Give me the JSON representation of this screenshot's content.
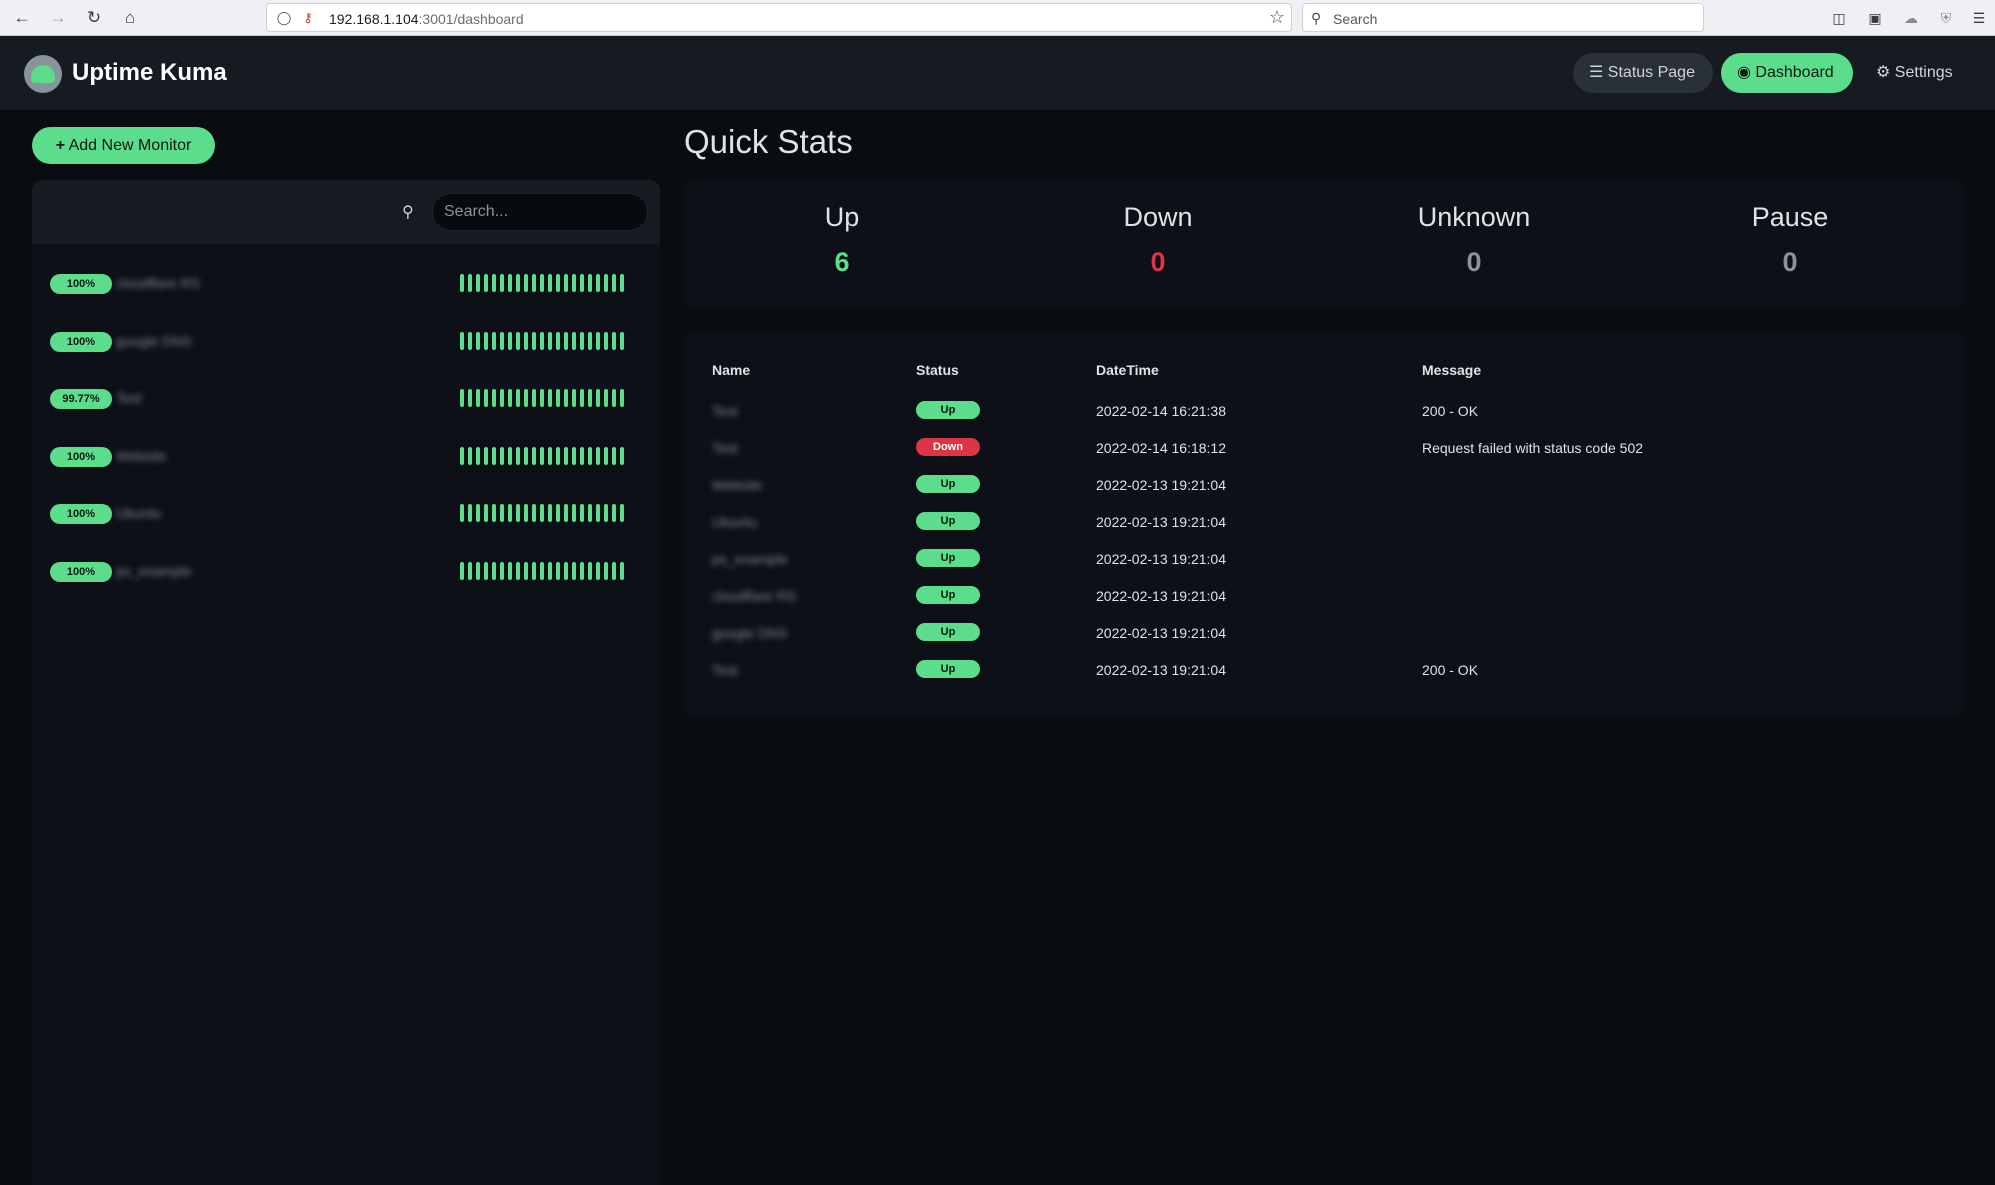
{
  "browser": {
    "url_host": "192.168.1.104",
    "url_path": ":3001/dashboard",
    "search_placeholder": "Search"
  },
  "header": {
    "title": "Uptime Kuma",
    "nav": {
      "status_page": "Status Page",
      "dashboard": "Dashboard",
      "settings": "Settings"
    }
  },
  "sidebar": {
    "add_button": "Add New Monitor",
    "search_placeholder": "Search...",
    "monitors": [
      {
        "uptime": "100%",
        "name": "cloudflare RS"
      },
      {
        "uptime": "100%",
        "name": "google DNS"
      },
      {
        "uptime": "99.77%",
        "name": "Test"
      },
      {
        "uptime": "100%",
        "name": "Website"
      },
      {
        "uptime": "100%",
        "name": "Ubuntu"
      },
      {
        "uptime": "100%",
        "name": "ps_example"
      }
    ],
    "heartbeats_per_monitor": 21
  },
  "main": {
    "title": "Quick Stats",
    "stats": [
      {
        "label": "Up",
        "value": "6",
        "color": "#5cdd8b"
      },
      {
        "label": "Down",
        "value": "0",
        "color": "#dc3545"
      },
      {
        "label": "Unknown",
        "value": "0",
        "color": "#8b929b"
      },
      {
        "label": "Pause",
        "value": "0",
        "color": "#8b929b"
      }
    ],
    "table": {
      "headers": {
        "name": "Name",
        "status": "Status",
        "datetime": "DateTime",
        "message": "Message"
      },
      "rows": [
        {
          "name": "Test",
          "status": "Up",
          "datetime": "2022-02-14 16:21:38",
          "message": "200 - OK"
        },
        {
          "name": "Test",
          "status": "Down",
          "datetime": "2022-02-14 16:18:12",
          "message": "Request failed with status code 502"
        },
        {
          "name": "Website",
          "status": "Up",
          "datetime": "2022-02-13 19:21:04",
          "message": ""
        },
        {
          "name": "Ubuntu",
          "status": "Up",
          "datetime": "2022-02-13 19:21:04",
          "message": ""
        },
        {
          "name": "ps_example",
          "status": "Up",
          "datetime": "2022-02-13 19:21:04",
          "message": ""
        },
        {
          "name": "cloudflare RS",
          "status": "Up",
          "datetime": "2022-02-13 19:21:04",
          "message": ""
        },
        {
          "name": "google DNS",
          "status": "Up",
          "datetime": "2022-02-13 19:21:04",
          "message": ""
        },
        {
          "name": "Test",
          "status": "Up",
          "datetime": "2022-02-13 19:21:04",
          "message": "200 - OK"
        }
      ]
    }
  },
  "colors": {
    "accent": "#5cdd8b",
    "danger": "#dc3545",
    "background": "#090c10",
    "panel": "#0d1117"
  }
}
